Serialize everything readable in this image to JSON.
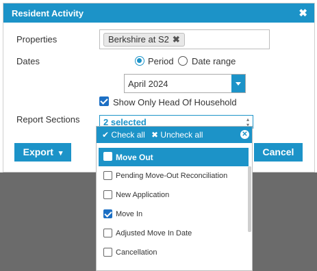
{
  "dialog": {
    "title": "Resident Activity",
    "close_glyph": "✖"
  },
  "form": {
    "properties_label": "Properties",
    "properties_tag": "Berkshire at S2",
    "tag_remove_glyph": "✖",
    "dates_label": "Dates",
    "date_mode_options": [
      "Period",
      "Date range"
    ],
    "date_mode_selected": "Period",
    "period_value": "April 2024",
    "head_of_household_label": "Show Only Head Of Household",
    "head_of_household_checked": true,
    "report_sections_label": "Report Sections",
    "report_sections_value": "2 selected",
    "caret_glyph": "▴▾"
  },
  "footer": {
    "export_label": "Export",
    "export_caret": "▾",
    "cancel_label": "Cancel"
  },
  "dropdown": {
    "check_all_label": "Check all",
    "check_all_icon": "✔",
    "uncheck_all_label": "Uncheck all",
    "uncheck_all_icon": "✖",
    "clear_icon": "✕",
    "options": [
      {
        "label": "Move Out",
        "checked": false,
        "highlighted": true
      },
      {
        "label": "Pending Move-Out Reconciliation",
        "checked": false,
        "highlighted": false
      },
      {
        "label": "New Application",
        "checked": false,
        "highlighted": false
      },
      {
        "label": "Move In",
        "checked": true,
        "highlighted": false
      },
      {
        "label": "Adjusted Move In Date",
        "checked": false,
        "highlighted": false
      },
      {
        "label": "Cancellation",
        "checked": false,
        "highlighted": false
      }
    ]
  },
  "colors": {
    "accent": "#1c93c8",
    "checkbox_checked": "#1c6fc4",
    "backdrop": "#6b6b6b"
  }
}
